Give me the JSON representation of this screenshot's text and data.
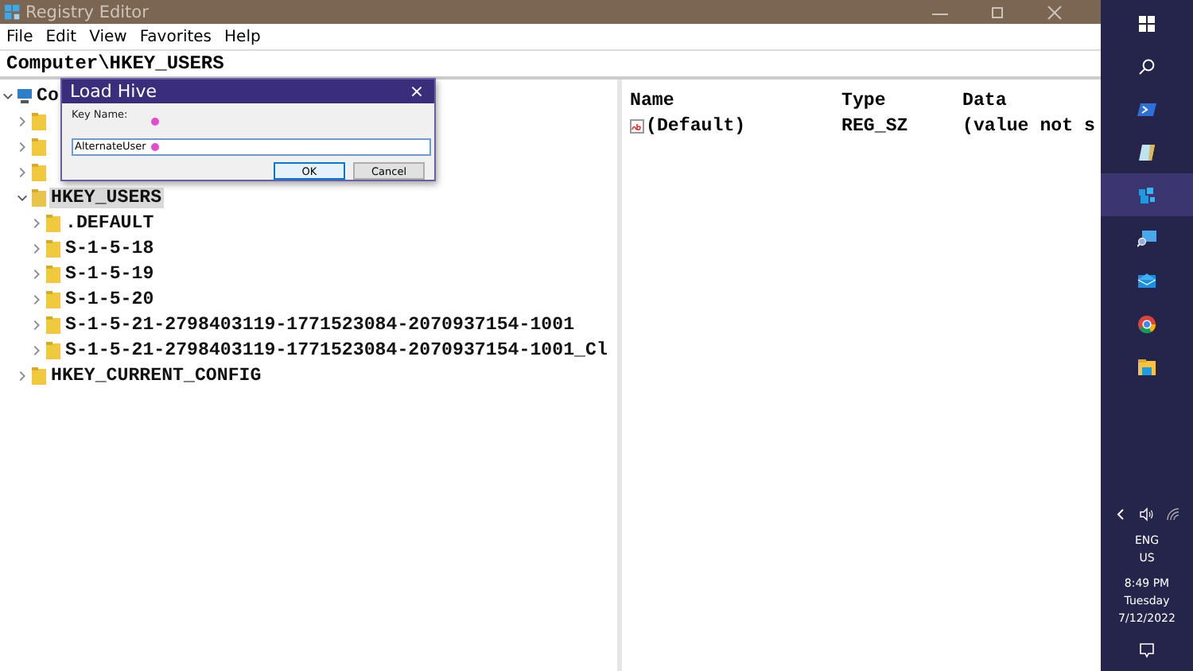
{
  "window": {
    "title": "Registry Editor"
  },
  "menu": [
    "File",
    "Edit",
    "View",
    "Favorites",
    "Help"
  ],
  "address": "Computer\\HKEY_USERS",
  "tree": [
    {
      "label": "Co",
      "kind": "computer",
      "expanded": true,
      "selected": false,
      "children": [
        {
          "kind": "folder",
          "expanded": false,
          "selected": false
        },
        {
          "kind": "folder",
          "expanded": false,
          "selected": false
        },
        {
          "kind": "folder",
          "expanded": false,
          "selected": false
        },
        {
          "label": "HKEY_USERS",
          "kind": "folder",
          "expanded": true,
          "selected": true,
          "children": [
            {
              "label": ".DEFAULT",
              "kind": "folder",
              "expanded": false,
              "selected": false
            },
            {
              "label": "S-1-5-18",
              "kind": "folder",
              "expanded": false,
              "selected": false
            },
            {
              "label": "S-1-5-19",
              "kind": "folder",
              "expanded": false,
              "selected": false
            },
            {
              "label": "S-1-5-20",
              "kind": "folder",
              "expanded": false,
              "selected": false
            },
            {
              "label": "S-1-5-21-2798403119-1771523084-2070937154-1001",
              "kind": "folder",
              "expanded": false,
              "selected": false
            },
            {
              "label": "S-1-5-21-2798403119-1771523084-2070937154-1001_Cl",
              "kind": "folder",
              "expanded": false,
              "selected": false
            }
          ]
        },
        {
          "label": "HKEY_CURRENT_CONFIG",
          "kind": "folder",
          "expanded": false,
          "selected": false
        }
      ]
    }
  ],
  "list": {
    "columns": [
      "Name",
      "Type",
      "Data"
    ],
    "rows": [
      {
        "name": "(Default)",
        "type": "REG_SZ",
        "data": "(value not s"
      }
    ]
  },
  "dialog": {
    "title": "Load Hive",
    "close": "×",
    "field_label": "Key Name:",
    "value": "AlternateUser",
    "buttons": [
      {
        "label": "OK",
        "default": true
      },
      {
        "label": "Cancel",
        "default": false
      }
    ]
  },
  "taskbar": {
    "apps": [
      {
        "kind": "start",
        "selected": false
      },
      {
        "kind": "search",
        "selected": false
      },
      {
        "kind": "powershell",
        "selected": false
      },
      {
        "kind": "notepad",
        "selected": false
      },
      {
        "kind": "regedit",
        "selected": true
      },
      {
        "kind": "remote",
        "selected": false
      },
      {
        "kind": "mail",
        "selected": false
      },
      {
        "kind": "chrome",
        "selected": false
      },
      {
        "kind": "explorer",
        "selected": false
      }
    ],
    "tray": {
      "language": "ENG",
      "region": "US",
      "time": "8:49 PM",
      "day": "Tuesday",
      "date": "7/12/2022"
    }
  }
}
